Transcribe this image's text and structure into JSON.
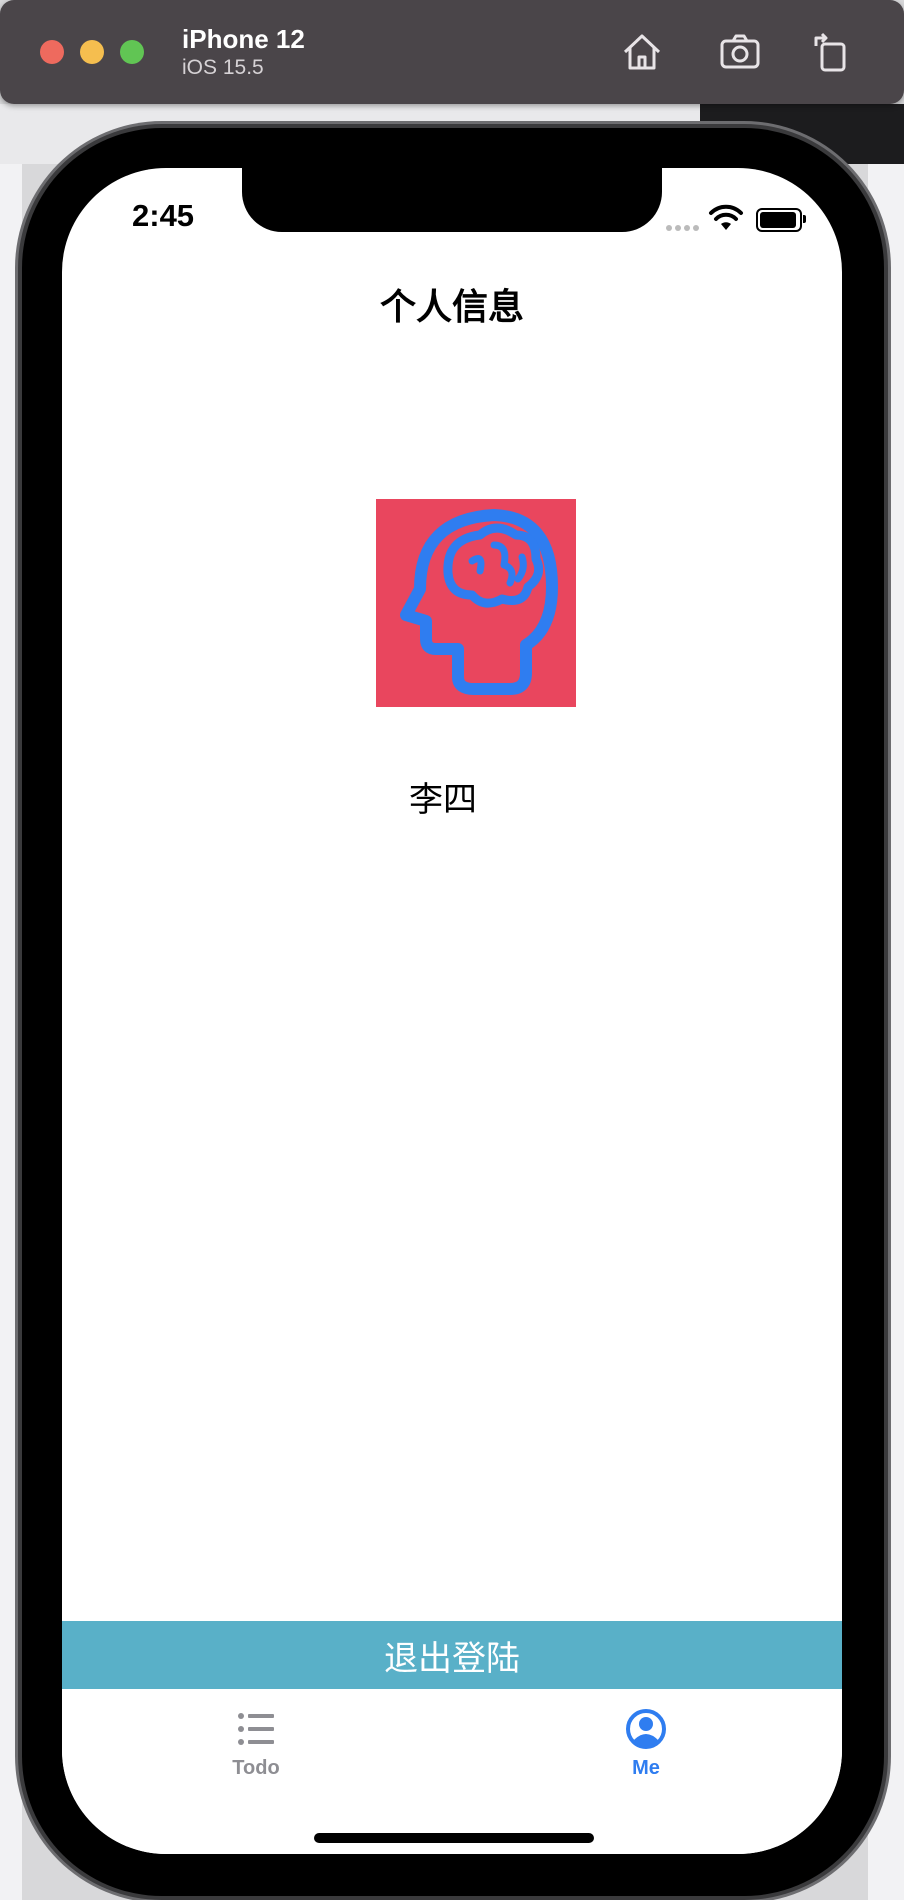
{
  "simulator": {
    "device_name": "iPhone 12",
    "os_version": "iOS 15.5",
    "toolbar_icons": [
      "home-icon",
      "screenshot-icon",
      "rotate-icon"
    ]
  },
  "status_bar": {
    "time": "2:45"
  },
  "page": {
    "title": "个人信息",
    "username": "李四",
    "avatar_icon": "brain-head-icon",
    "logout_label": "退出登陆"
  },
  "tab_bar": {
    "items": [
      {
        "label": "Todo",
        "icon": "list-icon",
        "active": false
      },
      {
        "label": "Me",
        "icon": "user-circle-icon",
        "active": true
      }
    ]
  },
  "colors": {
    "accent": "#2f7df0",
    "logout_button": "#59b0c8",
    "avatar_bg": "#e9465e",
    "inactive_tab": "#8e8e93"
  }
}
